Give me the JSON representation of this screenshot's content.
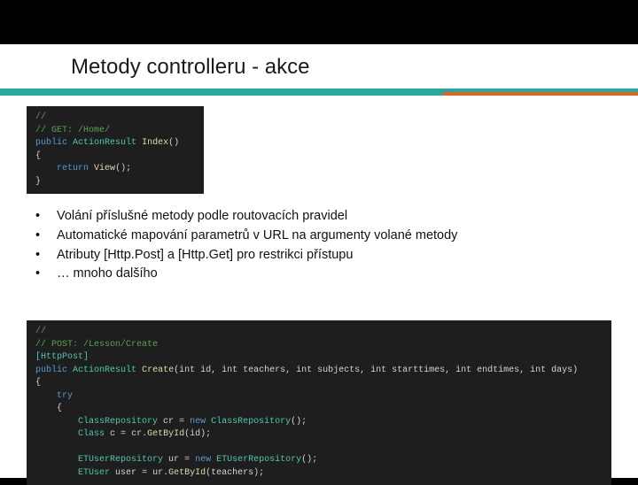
{
  "title": "Metody controlleru - akce",
  "code1": {
    "c1": "//",
    "c2": "// GET: /Home/",
    "l1a": "public",
    "l1b": "ActionResult",
    "l1c": "Index",
    "l1d": "()",
    "l2": "{",
    "l3a": "return",
    "l3b": "View",
    "l3c": "();",
    "l4": "}"
  },
  "bullets": [
    "Volání příslušné metody podle routovacích pravidel",
    "Automatické mapování parametrů v URL na argumenty volané metody",
    "Atributy [Http.Post] a [Http.Get] pro restrikci přístupu",
    "… mnoho dalšího"
  ],
  "code2": {
    "c1": "//",
    "c2": "// POST: /Lesson/Create",
    "attr": "[HttpPost]",
    "sigA": "public",
    "sigB": "ActionResult",
    "sigC": "Create",
    "sigD": "(int id, int teachers, int subjects, int starttimes, int endtimes, int days)",
    "lb": "{",
    "tryKw": "try",
    "lb2": "{",
    "r1a": "ClassRepository",
    "r1b": "cr",
    "r1c": " = ",
    "r1d": "new",
    "r1e": "ClassRepository",
    "r1f": "();",
    "r2a": "Class",
    "r2b": "c",
    "r2c": " = cr.",
    "r2d": "GetById",
    "r2e": "(id);",
    "blank": "",
    "r3a": "ETUserRepository",
    "r3b": "ur",
    "r3c": " = ",
    "r3d": "new",
    "r3e": "ETUserRepository",
    "r3f": "();",
    "r4a": "ETUser",
    "r4b": "user",
    "r4c": " = ur.",
    "r4d": "GetById",
    "r4e": "(teachers);"
  }
}
